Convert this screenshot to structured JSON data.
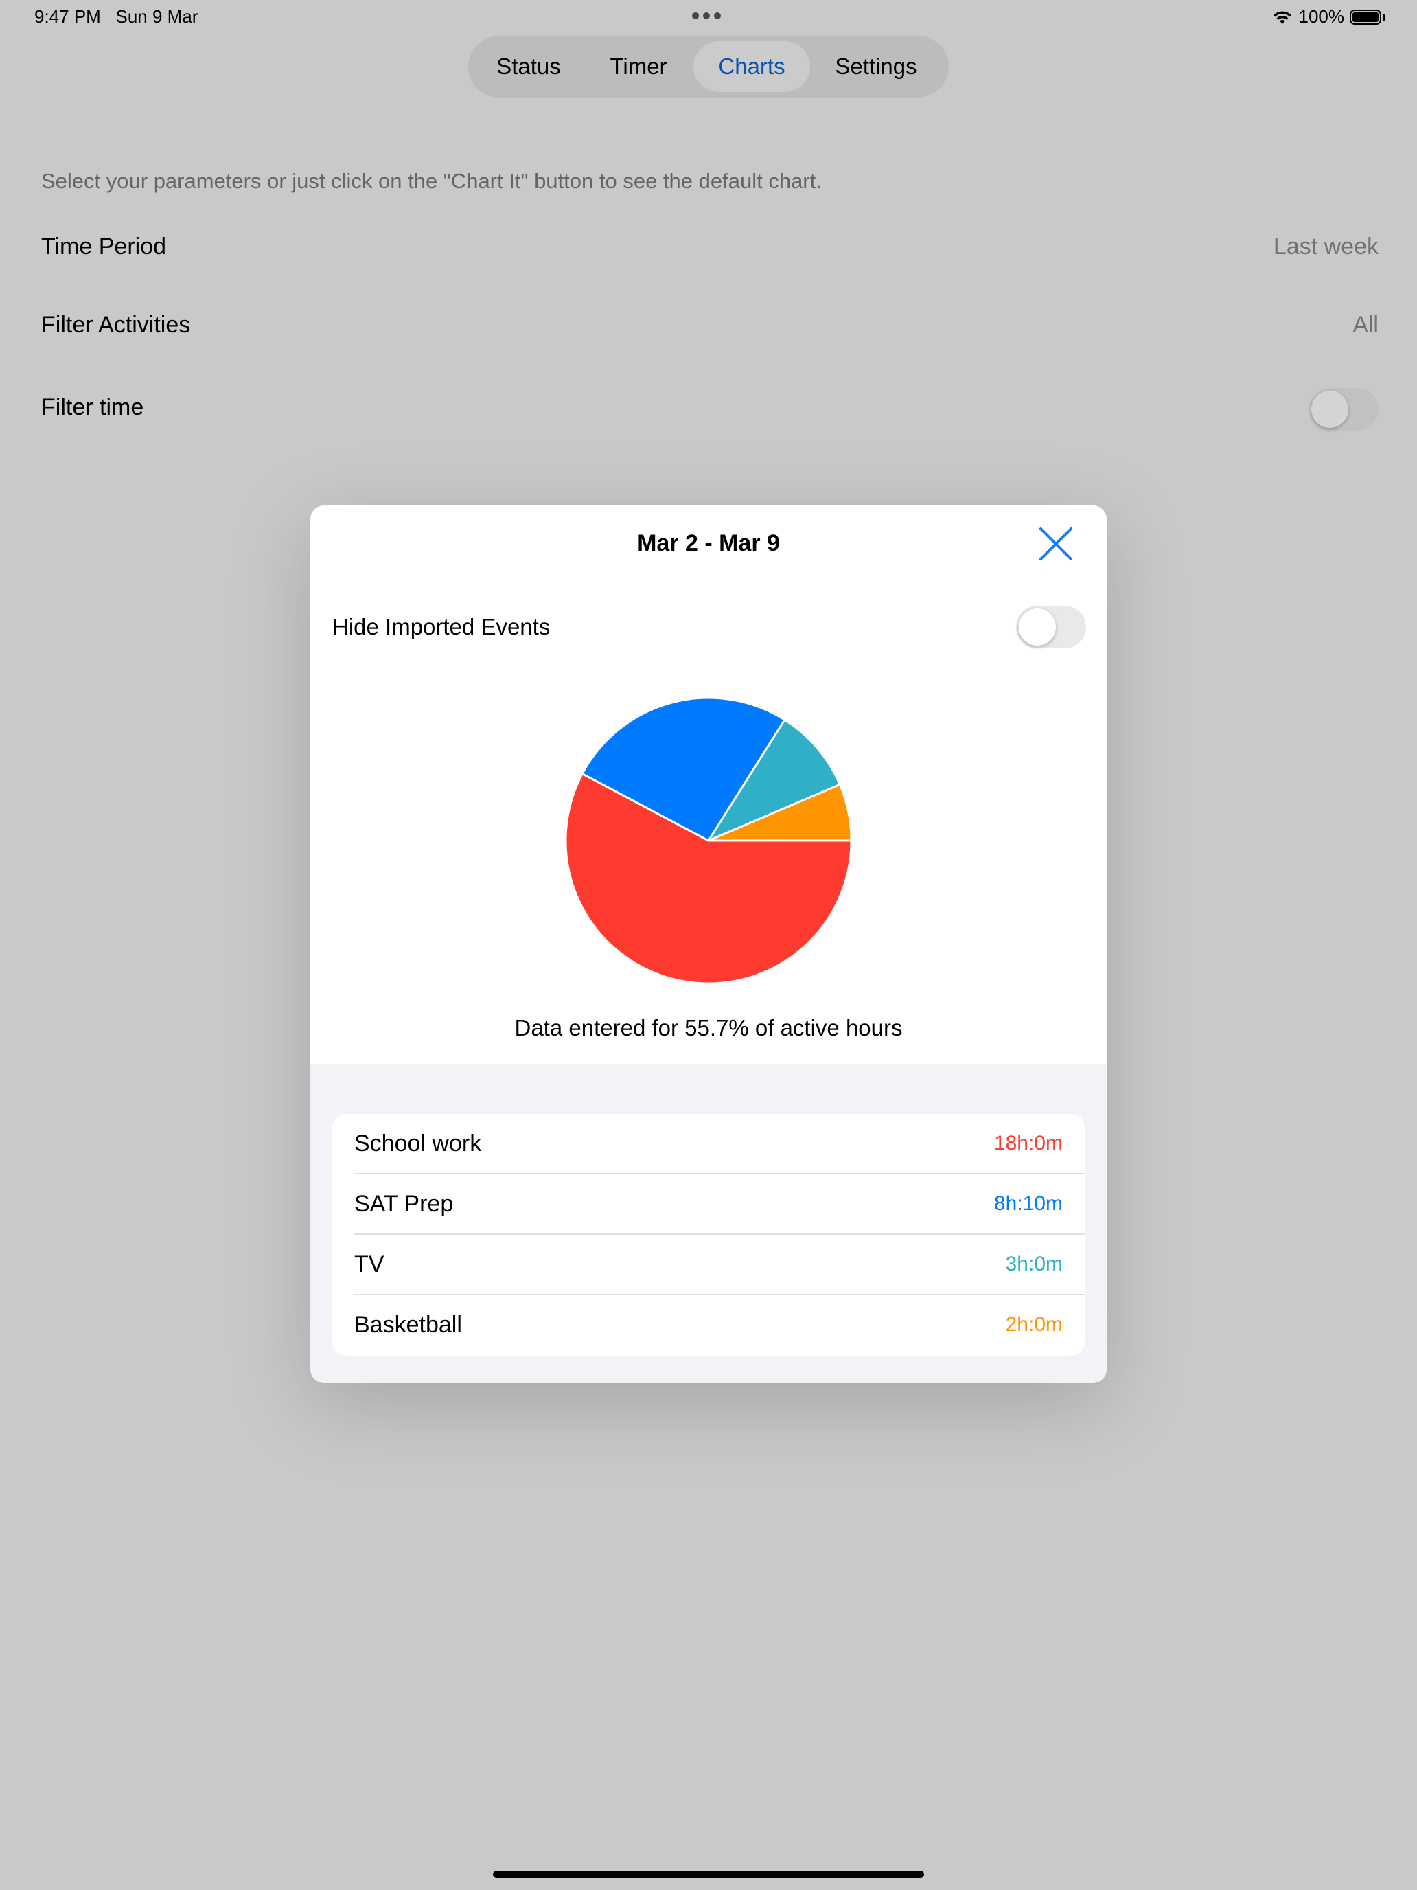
{
  "status_bar": {
    "time": "9:47 PM",
    "date": "Sun 9 Mar",
    "battery": "100%"
  },
  "tabs": [
    {
      "label": "Status",
      "active": false
    },
    {
      "label": "Timer",
      "active": false
    },
    {
      "label": "Charts",
      "active": true
    },
    {
      "label": "Settings",
      "active": false
    }
  ],
  "intro_text": "Select your parameters or just click on the \"Chart It\" button to see the default chart.",
  "params": {
    "time_period": {
      "label": "Time Period",
      "value": "Last week"
    },
    "filter_activities": {
      "label": "Filter Activities",
      "value": "All"
    },
    "filter_time": {
      "label": "Filter time",
      "enabled": false
    }
  },
  "modal": {
    "title": "Mar 2 - Mar 9",
    "hide_imported": {
      "label": "Hide Imported Events",
      "enabled": false
    },
    "caption": "Data entered for 55.7% of active hours"
  },
  "chart_data": {
    "type": "pie",
    "slices": [
      {
        "label": "School work",
        "display": "18h:0m",
        "value_minutes": 1080,
        "color": "#ff3b30"
      },
      {
        "label": "SAT Prep",
        "display": "8h:10m",
        "value_minutes": 490,
        "color": "#007aff"
      },
      {
        "label": "TV",
        "display": "3h:0m",
        "value_minutes": 180,
        "color": "#30b0c7"
      },
      {
        "label": "Basketball",
        "display": "2h:0m",
        "value_minutes": 120,
        "color": "#ff9500"
      }
    ]
  },
  "colors": {
    "accent": "#0a64d6",
    "school_work": "#ff3b30",
    "sat_prep": "#007aff",
    "tv": "#30b0c7",
    "basketball": "#ff9500"
  },
  "icons": {
    "close": "close-icon",
    "wifi": "wifi-icon",
    "battery": "battery-icon"
  }
}
